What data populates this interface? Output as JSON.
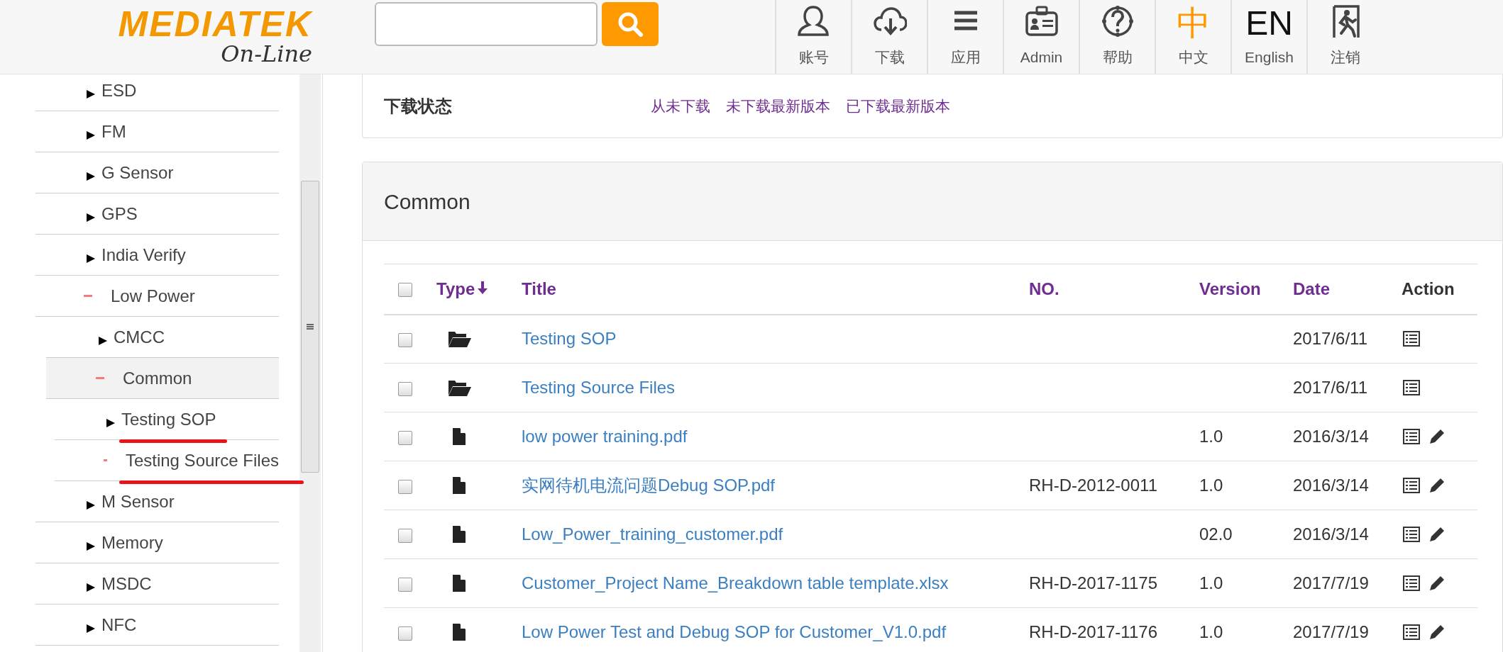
{
  "header": {
    "logo": {
      "brand": "MEDIATEK",
      "tagline": "On-Line"
    },
    "nav": [
      {
        "kind": "user",
        "label": "账号"
      },
      {
        "kind": "cloud",
        "label": "下载"
      },
      {
        "kind": "menu",
        "label": "应用"
      },
      {
        "kind": "badge",
        "label": "Admin"
      },
      {
        "kind": "help",
        "label": "帮助"
      },
      {
        "kind": "text",
        "glyph": "中",
        "label": "中文",
        "selected": true
      },
      {
        "kind": "text",
        "glyph": "EN",
        "label": "English",
        "selected": false
      },
      {
        "kind": "exit",
        "label": "注销"
      }
    ]
  },
  "sidebar": {
    "items": [
      {
        "label": "ESD",
        "expanded": false,
        "selected": false
      },
      {
        "label": "FM",
        "expanded": false,
        "selected": false
      },
      {
        "label": "G Sensor",
        "expanded": false,
        "selected": false
      },
      {
        "label": "GPS",
        "expanded": false,
        "selected": false
      },
      {
        "label": "India Verify",
        "expanded": false,
        "selected": false
      },
      {
        "label": "Low Power",
        "expanded": true,
        "selected": false,
        "children": [
          {
            "label": "CMCC",
            "expanded": false,
            "selected": false
          },
          {
            "label": "Common",
            "expanded": true,
            "selected": true,
            "children": [
              {
                "label": "Testing SOP",
                "expanded": false,
                "selected": false,
                "underlined": true
              },
              {
                "label": "Testing Source Files",
                "expanded": true,
                "selected": false,
                "underlined": true
              }
            ]
          }
        ]
      },
      {
        "label": "M Sensor",
        "expanded": false,
        "selected": false
      },
      {
        "label": "Memory",
        "expanded": false,
        "selected": false
      },
      {
        "label": "MSDC",
        "expanded": false,
        "selected": false
      },
      {
        "label": "NFC",
        "expanded": false,
        "selected": false
      }
    ]
  },
  "download_status": {
    "label": "下载状态",
    "links": [
      "从未下载",
      "未下载最新版本",
      "已下载最新版本"
    ]
  },
  "panel": {
    "title": "Common",
    "table": {
      "select_all_checked": false,
      "columns": [
        "Type",
        "Title",
        "NO.",
        "Version",
        "Date",
        "Action"
      ],
      "rows": [
        {
          "kind": "folder",
          "checked": false,
          "title": "Testing SOP",
          "no": "",
          "version": "",
          "date": "2017/6/11",
          "editable": false
        },
        {
          "kind": "folder",
          "checked": false,
          "title": "Testing Source Files",
          "no": "",
          "version": "",
          "date": "2017/6/11",
          "editable": false
        },
        {
          "kind": "file",
          "checked": false,
          "title": "low power training.pdf",
          "no": "",
          "version": "1.0",
          "date": "2016/3/14",
          "editable": true
        },
        {
          "kind": "file",
          "checked": false,
          "title": "实网待机电流问题Debug SOP.pdf",
          "no": "RH-D-2012-0011",
          "version": "1.0",
          "date": "2016/3/14",
          "editable": true
        },
        {
          "kind": "file",
          "checked": false,
          "title": "Low_Power_training_customer.pdf",
          "no": "",
          "version": "02.0",
          "date": "2016/3/14",
          "editable": true
        },
        {
          "kind": "file",
          "checked": false,
          "title": "Customer_Project Name_Breakdown table template.xlsx",
          "no": "RH-D-2017-1175",
          "version": "1.0",
          "date": "2017/7/19",
          "editable": true
        },
        {
          "kind": "file",
          "checked": false,
          "title": "Low Power Test and Debug SOP for Customer_V1.0.pdf",
          "no": "RH-D-2017-1176",
          "version": "1.0",
          "date": "2017/7/19",
          "editable": true
        }
      ]
    }
  }
}
